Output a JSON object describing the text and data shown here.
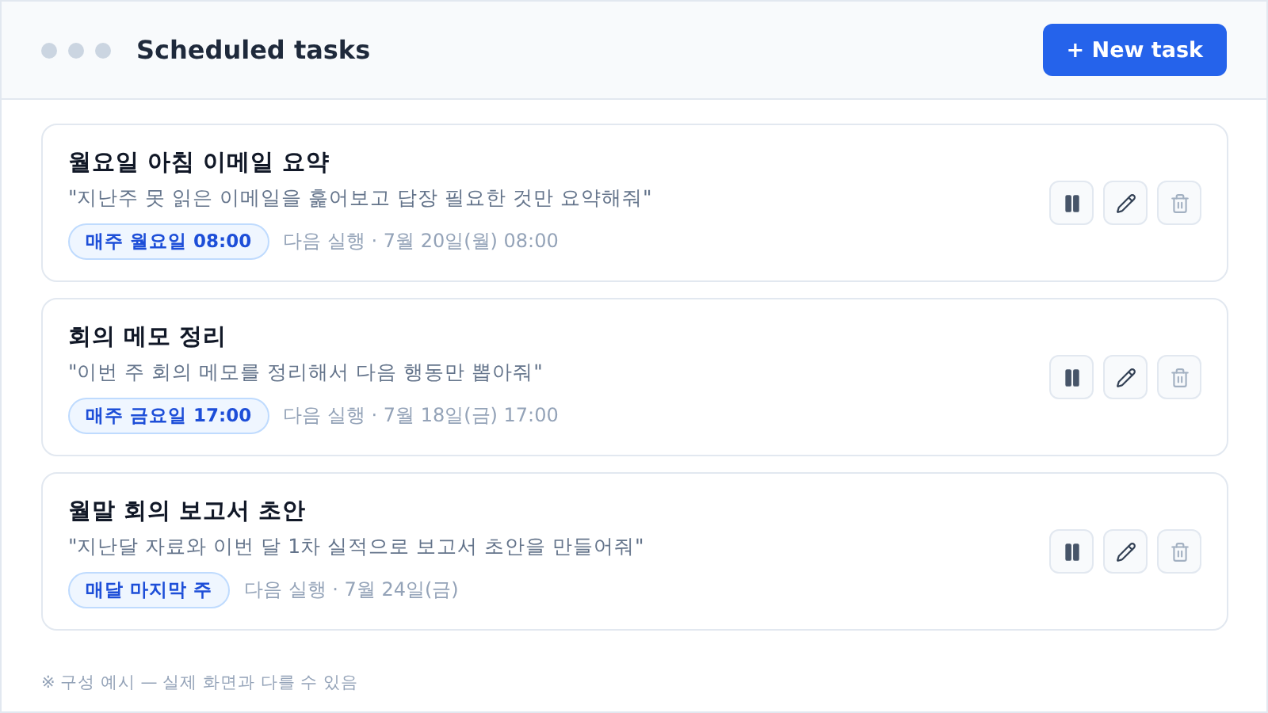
{
  "window": {
    "title": "Scheduled tasks"
  },
  "new_task_button": "+ New task",
  "tasks": [
    {
      "title": "월요일 아침 이메일 요약",
      "prompt": "\"지난주 못 읽은 이메일을 훑어보고 답장 필요한 것만 요약해줘\"",
      "schedule": "매주 월요일 08:00",
      "next_run": "다음 실행 · 7월 20일(월) 08:00"
    },
    {
      "title": "회의 메모 정리",
      "prompt": "\"이번 주 회의 메모를 정리해서 다음 행동만 뽑아줘\"",
      "schedule": "매주 금요일 17:00",
      "next_run": "다음 실행 · 7월 18일(금) 17:00"
    },
    {
      "title": "월말 회의 보고서 초안",
      "prompt": "\"지난달 자료와 이번 달 1차 실적으로 보고서 초안을 만들어줘\"",
      "schedule": "매달 마지막 주",
      "next_run": "다음 실행 · 7월 24일(금)"
    }
  ],
  "footer_note": "※ 구성 예시 — 실제 화면과 다를 수 있음"
}
